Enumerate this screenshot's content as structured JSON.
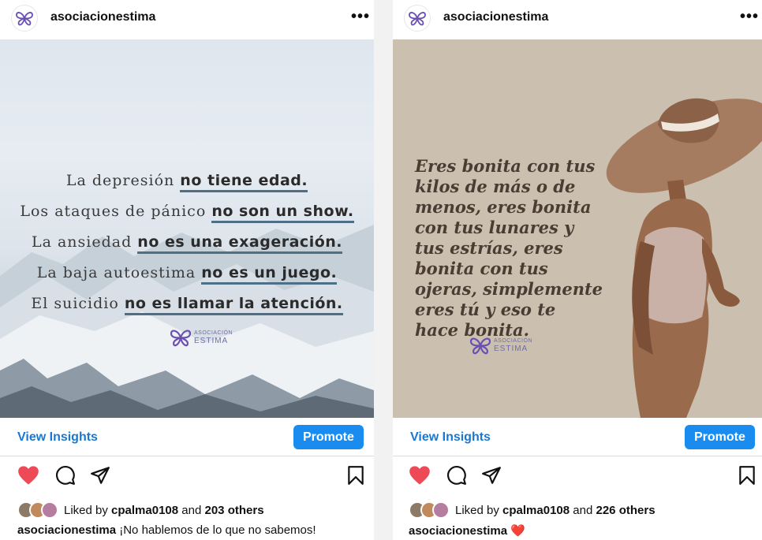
{
  "posts": [
    {
      "username": "asociacionestima",
      "more_label": "•••",
      "image_lines": [
        {
          "pre": "La depresión ",
          "bold": "no tiene edad."
        },
        {
          "pre": "Los ataques de pánico ",
          "bold": "no son un show."
        },
        {
          "pre": "La ansiedad ",
          "bold": "no es una exageración."
        },
        {
          "pre": "La baja autoestima ",
          "bold": "no es un juego."
        },
        {
          "pre": "El suicidio ",
          "bold": "no es llamar la atención."
        }
      ],
      "logo_line1": "ASOCIACIÓN",
      "logo_line2": "ESTIMA",
      "insights_label": "View Insights",
      "promote_label": "Promote",
      "liked_prefix": "Liked by ",
      "liked_user": "cpalma0108",
      "liked_mid": " and ",
      "liked_count": "203 others",
      "caption_user": "asociacionestima",
      "caption_text": " ¡No hablemos de lo que no sabemos!"
    },
    {
      "username": "asociacionestima",
      "more_label": "•••",
      "image_text": "Eres bonita con tus kilos de más o de menos, eres bonita con tus lunares y tus estrías, eres bonita con tus ojeras, simplemente eres tú y eso te hace bonita.",
      "logo_line1": "ASOCIACIÓN",
      "logo_line2": "ESTIMA",
      "insights_label": "View Insights",
      "promote_label": "Promote",
      "liked_prefix": "Liked by ",
      "liked_user": "cpalma0108",
      "liked_mid": " and ",
      "liked_count": "226 others",
      "caption_user": "asociacionestima",
      "caption_text": " ❤️"
    }
  ],
  "colors": {
    "like_red": "#ed4956",
    "link_blue": "#1a77d2",
    "promote_blue": "#1a8cf0",
    "brand_purple": "#6a4fb3"
  },
  "icons": [
    "butterfly-logo-icon",
    "more-icon",
    "heart-filled-icon",
    "comment-icon",
    "share-icon",
    "bookmark-icon"
  ]
}
